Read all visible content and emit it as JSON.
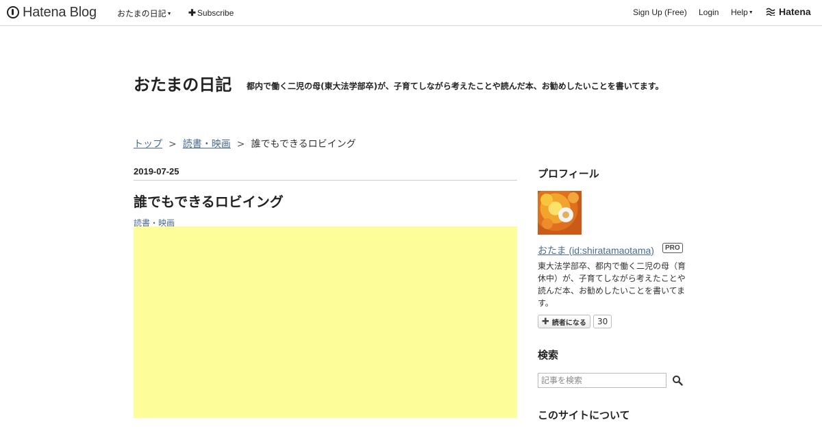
{
  "topbar": {
    "logo_text": "Hatena Blog",
    "blog_menu_label": "おたまの日記",
    "subscribe_label": "Subscribe",
    "signup_label": "Sign Up (Free)",
    "login_label": "Login",
    "help_label": "Help",
    "hatena_label": "Hatena"
  },
  "header": {
    "title": "おたまの日記",
    "description": "都内で働く二児の母(東大法学部卒)が、子育てしながら考えたことや読んだ本、お勧めしたいことを書いてます。"
  },
  "breadcrumb": {
    "items": [
      "トップ",
      "読書・映画",
      "誰でもできるロビイング"
    ],
    "separator": ">"
  },
  "article": {
    "date": "2019-07-25",
    "title": "誰でもできるロビイング",
    "category": "読書・映画",
    "ad_color": "#fdfd9a"
  },
  "sidebar": {
    "profile": {
      "heading": "プロフィール",
      "name": "おたま (id:shiratamaotama)",
      "badge": "PRO",
      "description": "東大法学部卒、都内で働く二児の母（育休中）が、子育てしながら考えたことや読んだ本、お勧めしたいことを書いてます。",
      "reader_button": "読者になる",
      "reader_count": "30"
    },
    "search": {
      "heading": "検索",
      "placeholder": "記事を検索"
    },
    "about": {
      "heading": "このサイトについて"
    }
  },
  "colors": {
    "link": "#4b6b8e",
    "ad_background": "#fdfd9a"
  }
}
